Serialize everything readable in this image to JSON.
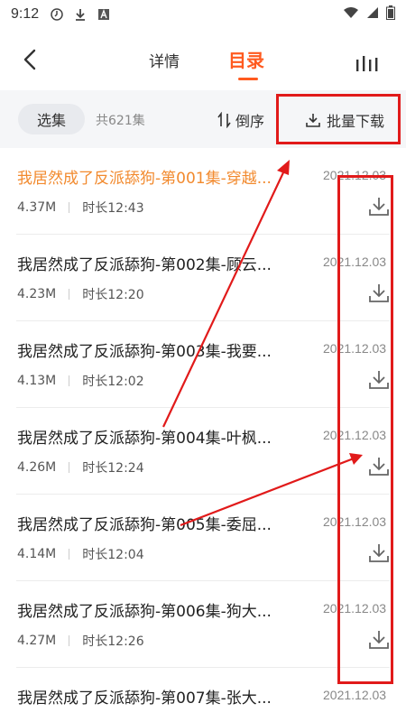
{
  "status_bar": {
    "time": "9:12",
    "left_icons": [
      "circle-clock-icon",
      "download-icon",
      "a-box-icon"
    ],
    "right_icons": [
      "wifi-icon",
      "signal-icon",
      "battery-icon"
    ]
  },
  "nav": {
    "tabs": [
      {
        "label": "详情",
        "active": false
      },
      {
        "label": "目录",
        "active": true
      }
    ],
    "accent_color": "#ff5a1f"
  },
  "toolbar": {
    "select_label": "选集",
    "total_count": "共621集",
    "sort_label": "倒序",
    "batch_download_label": "批量下载"
  },
  "episodes": [
    {
      "title": "我居然成了反派舔狗-第001集-穿越...",
      "size": "4.37M",
      "duration": "时长12:43",
      "date": "2021.12.03",
      "active": true
    },
    {
      "title": "我居然成了反派舔狗-第002集-顾云...",
      "size": "4.23M",
      "duration": "时长12:20",
      "date": "2021.12.03",
      "active": false
    },
    {
      "title": "我居然成了反派舔狗-第003集-我要...",
      "size": "4.13M",
      "duration": "时长12:02",
      "date": "2021.12.03",
      "active": false
    },
    {
      "title": "我居然成了反派舔狗-第004集-叶枫...",
      "size": "4.26M",
      "duration": "时长12:24",
      "date": "2021.12.03",
      "active": false
    },
    {
      "title": "我居然成了反派舔狗-第005集-委屈...",
      "size": "4.14M",
      "duration": "时长12:04",
      "date": "2021.12.03",
      "active": false
    },
    {
      "title": "我居然成了反派舔狗-第006集-狗大...",
      "size": "4.27M",
      "duration": "时长12:26",
      "date": "2021.12.03",
      "active": false
    },
    {
      "title": "我居然成了反派舔狗-第007集-张大...",
      "size": "",
      "duration": "",
      "date": "2021.12.03",
      "active": false
    }
  ],
  "annotation_color": "#e11a1a"
}
